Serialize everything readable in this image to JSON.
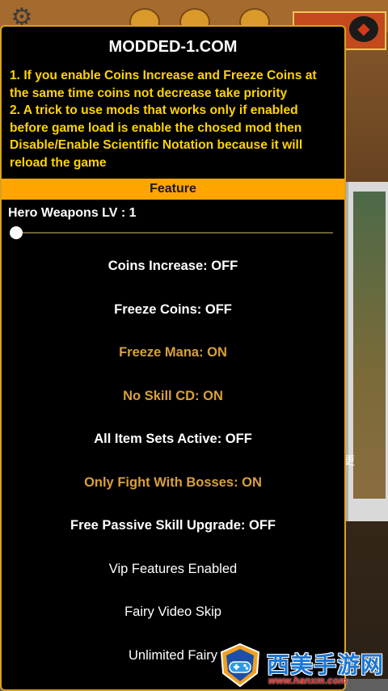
{
  "menu": {
    "title": "MODDED-1.COM",
    "notes": [
      "1. If you enable Coins Increase and Freeze Coins at the same time coins not decrease take priority",
      "2. A trick to use mods that works only if enabled before game load is enable the chosed mod then Disable/Enable Scientific Notation because it will reload the game"
    ],
    "feature_header": "Feature",
    "slider": {
      "label": "Hero Weapons LV : 1",
      "value": 1
    },
    "toggles": [
      {
        "label": "Coins Increase: OFF",
        "state": "off"
      },
      {
        "label": "Freeze Coins: OFF",
        "state": "off"
      },
      {
        "label": "Freeze Mana: ON",
        "state": "on"
      },
      {
        "label": "No Skill CD: ON",
        "state": "on"
      },
      {
        "label": "All Item Sets Active: OFF",
        "state": "off"
      },
      {
        "label": "Only Fight With Bosses: ON",
        "state": "on"
      },
      {
        "label": "Free Passive Skill Upgrade: OFF",
        "state": "off"
      },
      {
        "label": "Vip Features Enabled",
        "state": "plain"
      },
      {
        "label": "Fairy Video Skip",
        "state": "plain"
      },
      {
        "label": "Unlimited Fairy",
        "state": "plain"
      }
    ]
  },
  "background": {
    "glyph": "更"
  },
  "watermark": {
    "text": "西美手游网",
    "url": "www.hanxm.com"
  },
  "colors": {
    "menu_border": "#d9a21f",
    "notes_text": "#ffd400",
    "feature_header_bg": "#ffa500",
    "toggle_on": "#d9a03a",
    "toggle_off": "#ffffff"
  },
  "icons": [
    "gear-icon",
    "cat-face-icon",
    "gamepad-shield-icon"
  ]
}
